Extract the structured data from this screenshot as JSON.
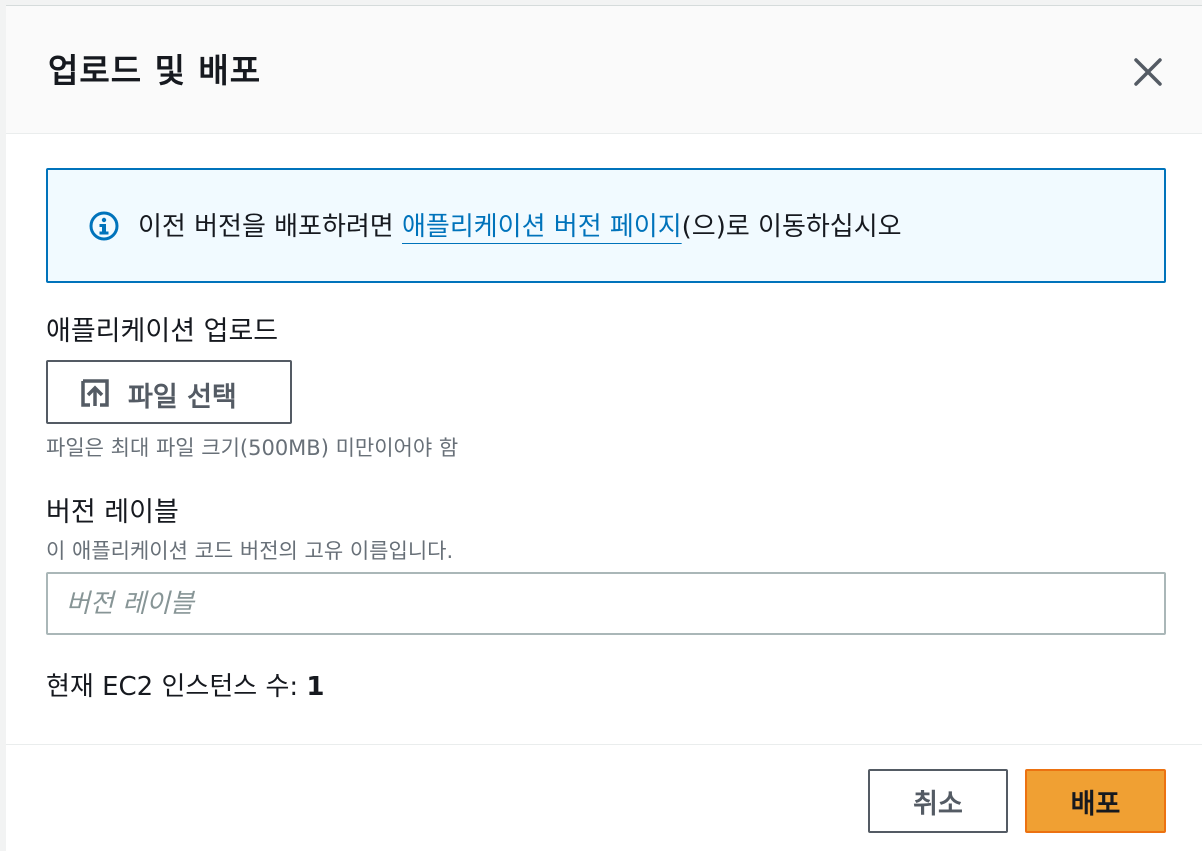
{
  "modal": {
    "title": "업로드 및 배포",
    "close_icon": "close-icon"
  },
  "alert": {
    "icon": "info-icon",
    "text_before": "이전 버전을 배포하려면 ",
    "link_text": "애플리케이션 버전 페이지",
    "text_after": "(으)로 이동하십시오",
    "accent_color": "#0073bb"
  },
  "upload": {
    "label": "애플리케이션 업로드",
    "button_label": "파일 선택",
    "button_icon": "upload-icon",
    "hint": "파일은 최대 파일 크기(500MB) 미만이어야 함"
  },
  "version_label": {
    "label": "버전 레이블",
    "description": "이 애플리케이션 코드 버전의 고유 이름입니다.",
    "value": "",
    "placeholder": "버전 레이블"
  },
  "instances": {
    "label": "현재 EC2 인스턴스 수: ",
    "count": "1"
  },
  "footer": {
    "cancel_label": "취소",
    "deploy_label": "배포",
    "primary_color": "#ec7211"
  }
}
